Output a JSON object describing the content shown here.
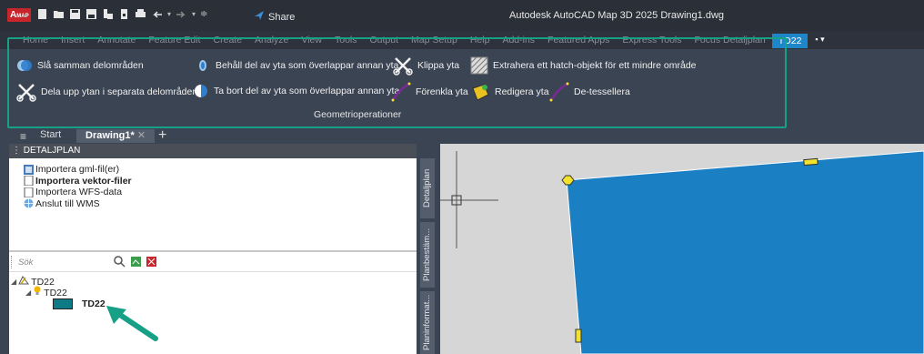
{
  "app": {
    "button_label": "A",
    "button_sub": "MAP",
    "share_label": "Share",
    "window_title": "Autodesk AutoCAD Map 3D 2025   Drawing1.dwg"
  },
  "ribbon_tabs": [
    "Home",
    "Insert",
    "Annotate",
    "Feature Edit",
    "Create",
    "Analyze",
    "View",
    "Tools",
    "Output",
    "Map Setup",
    "Help",
    "Add-ins",
    "Featured Apps",
    "Express Tools",
    "Focus Detaljplan",
    "TD22"
  ],
  "ribbon_tab_extra": "▪ ▾",
  "ribbon": {
    "buttons": {
      "merge": "Slå samman delområden",
      "keep_overlap": "Behåll del av yta som överlappar annan yta",
      "clip": "Klippa yta",
      "extract_hatch": "Extrahera ett hatch-objekt för ett mindre område",
      "split": "Dela upp ytan i separata delområden",
      "remove_overlap": "Ta bort del av yta som överlappar annan yta",
      "simplify": "Förenkla yta",
      "edit": "Redigera yta",
      "detessellate": "De-tessellera"
    },
    "panel_label": "Geometrioperationer"
  },
  "doc_tabs": {
    "menu": "≡",
    "start": "Start",
    "active": "Drawing1*",
    "close": "✕",
    "new": "+"
  },
  "palette": {
    "header": "DETALJPLAN",
    "items": [
      {
        "label": "Importera gml-fil(er)",
        "bold": false
      },
      {
        "label": "Importera vektor-filer",
        "bold": true
      },
      {
        "label": "Importera WFS-data",
        "bold": false
      },
      {
        "label": "Anslut till WMS",
        "bold": false
      }
    ],
    "search_placeholder": "Sök",
    "tree": {
      "root": "TD22",
      "child": "TD22",
      "leaf": "TD22"
    }
  },
  "side_tabs": [
    "Detaljplan",
    "Planbestäm...",
    "Planinformat..."
  ],
  "colors": {
    "accent": "#1e87c9",
    "highlight_border": "#16a085",
    "polygon_fill": "#1b7fc3",
    "grip": "#f2e22b",
    "swatch": "#0d7a86",
    "annotation_arrow": "#16a085"
  }
}
